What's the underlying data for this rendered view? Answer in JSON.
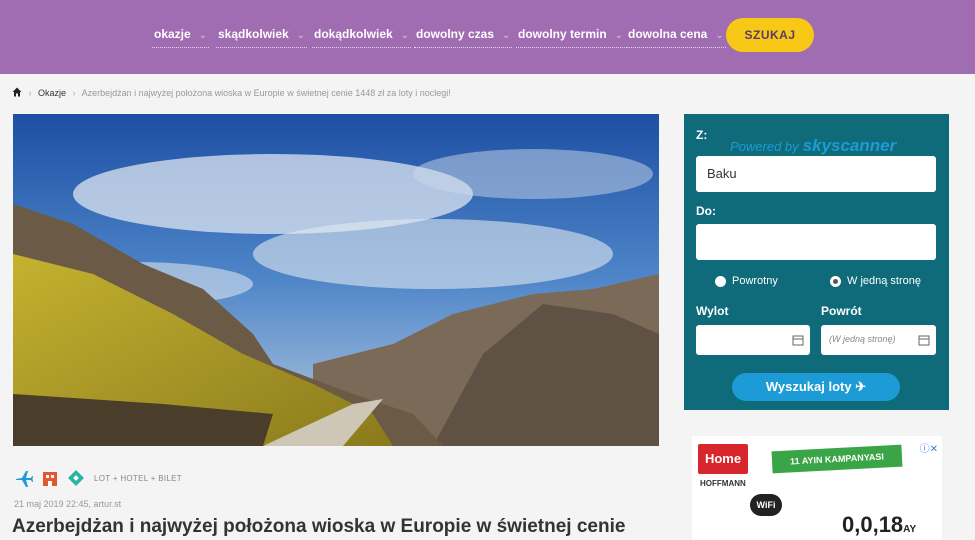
{
  "nav": {
    "items": [
      {
        "label": "okazje"
      },
      {
        "label": "skądkolwiek"
      },
      {
        "label": "dokądkolwiek"
      },
      {
        "label": "dowolny czas"
      },
      {
        "label": "dowolny termin"
      },
      {
        "label": "dowolna cena"
      }
    ],
    "search_label": "SZUKAJ"
  },
  "breadcrumb": {
    "link": "Okazje",
    "current": "Azerbejdżan i najwyżej położona wioska w Europie w świetnej cenie 1448 zł za loty i noclegi!"
  },
  "article": {
    "tags_label": "LOT + HOTEL + BILET",
    "meta": "21 maj 2019 22:45, artur.st",
    "title": "Azerbejdżan i najwyżej położona wioska w Europie w świetnej cenie"
  },
  "widget": {
    "from_label": "Z:",
    "powered_by": "Powered by",
    "brand": "skyscanner",
    "from_value": "Baku",
    "to_label": "Do:",
    "to_value": "",
    "radio_return": "Powrotny",
    "radio_oneway": "W jedną stronę",
    "selected_trip": "W jedną stronę",
    "depart_label": "Wylot",
    "return_label": "Powrót",
    "return_placeholder": "(W jedną stronę)",
    "search_label": "Wyszukaj loty"
  },
  "ad": {
    "logo": "Home",
    "campaign": "11 AYIN KAMPANYASI",
    "hoffmann": "HOFFMANN",
    "wifi": "WiFi",
    "price": "0,0,18",
    "price_suffix": "AY",
    "adchoices": "ⓘ✕"
  },
  "colors": {
    "topbar": "#a06db2",
    "search_button": "#f7c916",
    "widget": "#0f6b7a",
    "accent": "#1c9bd6"
  }
}
